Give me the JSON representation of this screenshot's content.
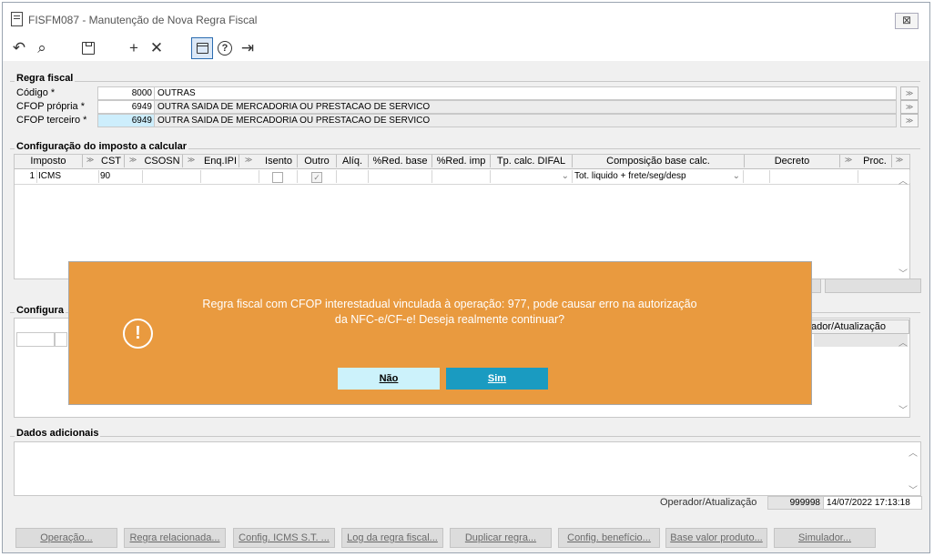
{
  "window": {
    "title": "FISFM087 - Manutenção de Nova Regra Fiscal",
    "close_glyph": "⊠"
  },
  "toolbar": {
    "icons": [
      "undo-icon",
      "search-icon",
      "save-icon",
      "add-icon",
      "delete-icon",
      "calendar-icon",
      "help-icon",
      "exit-icon"
    ],
    "glyphs": {
      "undo": "↶",
      "search": "⌕",
      "save": "💾",
      "add": "+",
      "delete": "✕",
      "calendar": "📅",
      "help": "?",
      "exit": "⇥"
    }
  },
  "regra": {
    "group_label": "Regra fiscal",
    "codigo_label": "Código *",
    "codigo_value": "8000",
    "codigo_desc": "OUTRAS",
    "cfop_propria_label": "CFOP própria *",
    "cfop_propria_value": "6949",
    "cfop_propria_desc": "OUTRA SAIDA DE MERCADORIA OU PRESTACAO DE SERVICO",
    "cfop_terceiro_label": "CFOP terceiro *",
    "cfop_terceiro_value": "6949",
    "cfop_terceiro_desc": "OUTRA SAIDA DE MERCADORIA OU PRESTACAO DE SERVICO",
    "lookup_glyph": "≫"
  },
  "config_imposto": {
    "group_label": "Configuração do imposto a calcular",
    "columns": [
      "Imposto",
      "CST",
      "CSOSN",
      "Enq.IPI",
      "Isento",
      "Outro",
      "Alíq.",
      "%Red. base",
      "%Red. imp",
      "Tp. calc. DIFAL",
      "Composição base calc.",
      "Decreto",
      "Proc."
    ],
    "row": {
      "index": "1",
      "imposto": "ICMS",
      "cst": "90",
      "isento": false,
      "outro": true,
      "composicao": "Tot. liquido + frete/seg/desp"
    }
  },
  "config2": {
    "group_label": "Configura",
    "partial_header": "ador/Atualização"
  },
  "dados": {
    "group_label": "Dados adicionais",
    "operador_label": "Operador/Atualização",
    "operador_value": "999998",
    "data_value": "14/07/2022 17:13:18"
  },
  "bottom_buttons": [
    "Operação...",
    "Regra relacionada...",
    "Config. ICMS S.T. ...",
    "Log da regra fiscal...",
    "Duplicar regra...",
    "Config. benefício...",
    "Base valor produto...",
    "Simulador..."
  ],
  "dialog": {
    "message_line1": "Regra fiscal com CFOP interestadual vinculada à operação: 977, pode causar erro na autorização",
    "message_line2": "da NFC-e/CF-e! Deseja realmente continuar?",
    "icon_glyph": "!",
    "no_label": "Não",
    "yes_label": "Sim",
    "bg_color": "#e99a3f"
  }
}
